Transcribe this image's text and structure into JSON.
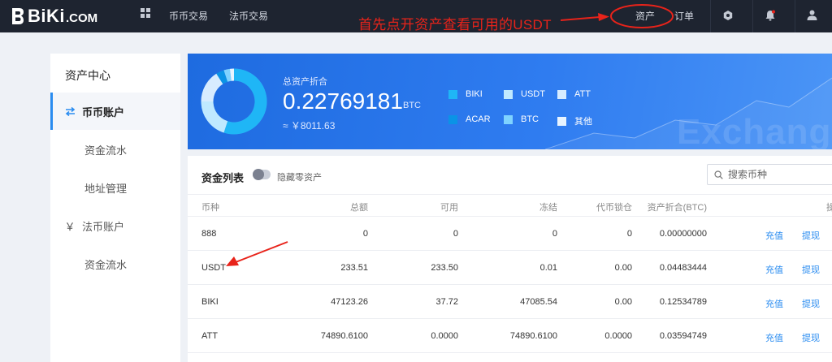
{
  "nav": {
    "logo": "BiKi",
    "logo_suffix": ".COM",
    "links": [
      "币币交易",
      "法币交易"
    ],
    "annotation": "首先点开资产查看可用的USDT",
    "assets": "资产",
    "orders": "订单",
    "icons": [
      "grid-icon",
      "hexagon-icon",
      "bell-icon",
      "user-icon"
    ],
    "annotation_color": "#e8231a"
  },
  "sidebar": {
    "title": "资产中心",
    "items": [
      {
        "label": "币币账户",
        "icon": "swap-icon",
        "active": true
      },
      {
        "label": "资金流水"
      },
      {
        "label": "地址管理"
      },
      {
        "label": "法币账户",
        "icon": "yen-icon"
      },
      {
        "label": "资金流水"
      }
    ]
  },
  "banner": {
    "total_label": "总资产折合",
    "total_value": "0.22769181",
    "total_unit": "BTC",
    "total_cny": "≈ ￥8011.63",
    "watermark": "Exchang",
    "legend": [
      {
        "label": "BIKI",
        "color": "#1fb6f6"
      },
      {
        "label": "USDT",
        "color": "#bfe9ff"
      },
      {
        "label": "ATT",
        "color": "#d7ecff"
      },
      {
        "label": "ACAR",
        "color": "#0a93e6"
      },
      {
        "label": "BTC",
        "color": "#7fd3ff"
      },
      {
        "label": "其他",
        "color": "#e8f4ff"
      }
    ],
    "donut": [
      {
        "label": "BIKI",
        "value": 0.55,
        "color": "#1fb6f6"
      },
      {
        "label": "USDT",
        "value": 0.2,
        "color": "#bfe9ff"
      },
      {
        "label": "ATT",
        "value": 0.16,
        "color": "#d7ecff"
      },
      {
        "label": "ACAR",
        "value": 0.04,
        "color": "#0a93e6"
      },
      {
        "label": "BTC",
        "value": 0.03,
        "color": "#7fd3ff"
      },
      {
        "label": "其他",
        "value": 0.02,
        "color": "#e8f4ff"
      }
    ]
  },
  "list": {
    "title": "资金列表",
    "hide_zero": "隐藏零资产",
    "search_placeholder": "搜索币种",
    "columns": [
      "币种",
      "总额",
      "可用",
      "冻结",
      "代币锁仓",
      "资产折合(BTC)",
      "操"
    ],
    "rows": [
      {
        "coin": "888",
        "total": "0",
        "available": "0",
        "frozen": "0",
        "locked": "0",
        "btc": "0.00000000",
        "deposit": "充值",
        "withdraw": "提现"
      },
      {
        "coin": "USDT",
        "total": "233.51",
        "available": "233.50",
        "frozen": "0.01",
        "locked": "0.00",
        "btc": "0.04483444",
        "deposit": "充值",
        "withdraw": "提现"
      },
      {
        "coin": "BIKI",
        "total": "47123.26",
        "available": "37.72",
        "frozen": "47085.54",
        "locked": "0.00",
        "btc": "0.12534789",
        "deposit": "充值",
        "withdraw": "提现"
      },
      {
        "coin": "ATT",
        "total": "74890.6100",
        "available": "0.0000",
        "frozen": "74890.6100",
        "locked": "0.0000",
        "btc": "0.03594749",
        "deposit": "充值",
        "withdraw": "提现"
      }
    ]
  }
}
